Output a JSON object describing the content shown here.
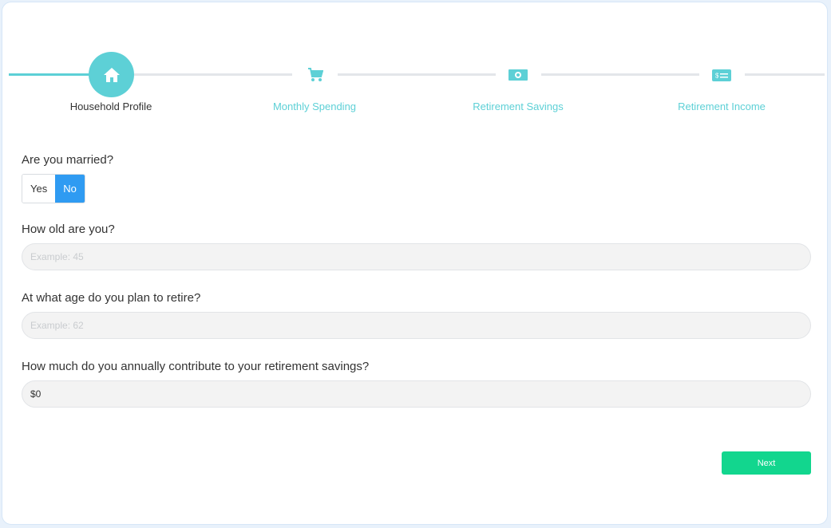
{
  "colors": {
    "accent_teal": "#5dd0d6",
    "toggle_selected": "#2f9bf2",
    "next_button": "#12d68e",
    "track_inactive": "#e3e6ea"
  },
  "stepper": {
    "steps": [
      {
        "label": "Household Profile",
        "icon": "home-icon",
        "active": true
      },
      {
        "label": "Monthly Spending",
        "icon": "shopping-cart-icon",
        "active": false
      },
      {
        "label": "Retirement Savings",
        "icon": "money-bill-icon",
        "active": false
      },
      {
        "label": "Retirement Income",
        "icon": "check-dollar-icon",
        "active": false
      }
    ]
  },
  "form": {
    "married": {
      "question": "Are you married?",
      "options": [
        "Yes",
        "No"
      ],
      "selected": "No"
    },
    "age": {
      "question": "How old are you?",
      "placeholder": "Example: 45",
      "value": ""
    },
    "retire_age": {
      "question": "At what age do you plan to retire?",
      "placeholder": "Example: 62",
      "value": ""
    },
    "contribution": {
      "question": "How much do you annually contribute to your retirement savings?",
      "value": "$0"
    }
  },
  "actions": {
    "next_label": "Next"
  }
}
